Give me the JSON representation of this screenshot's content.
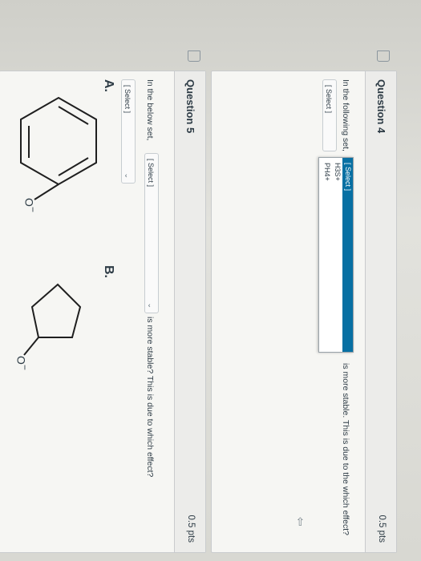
{
  "question4": {
    "title": "Question 4",
    "points": "0.5 pts",
    "prompt": "In the following set,",
    "after": "is more stable. This is due to the which effect?",
    "dropdown_options": [
      "[ Select ]",
      "H3S+",
      "PH4+"
    ],
    "select2": "[ Select ]"
  },
  "question5": {
    "title": "Question 5",
    "points": "0.5 pts",
    "prompt": "In the below set,",
    "select1": "[ Select ]",
    "after": "is more stable? This is due to which effect?",
    "select2": "[ Select ]",
    "label_a": "A.",
    "label_b": "B.",
    "charge_a": "O",
    "charge_b": "O",
    "minus": "−"
  },
  "colors": {
    "accent": "#0770a3",
    "text": "#2d3b45",
    "border": "#c9cbcd"
  }
}
